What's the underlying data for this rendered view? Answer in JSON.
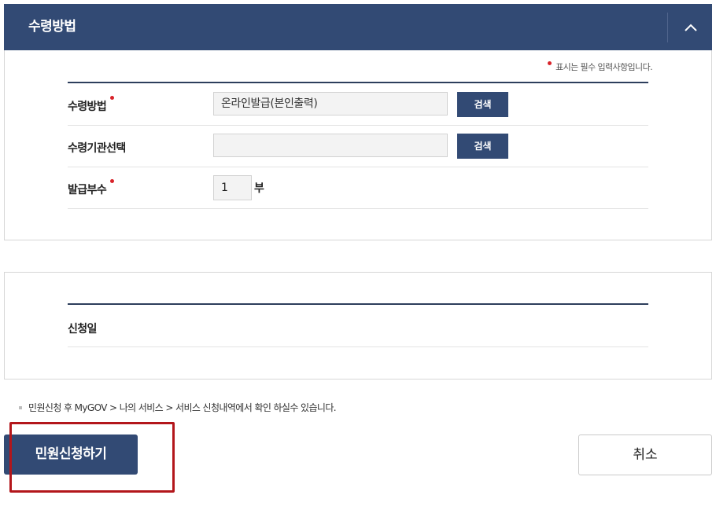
{
  "receipt_section": {
    "title": "수령방법",
    "required_note": "표시는 필수 입력사항입니다.",
    "rows": [
      {
        "label": "수령방법",
        "value": "온라인발급(본인출력)",
        "button": "검색",
        "required": true
      },
      {
        "label": "수령기관선택",
        "value": "",
        "button": "검색",
        "required": false
      },
      {
        "label": "발급부수",
        "value": "1",
        "unit": "부",
        "required": true
      }
    ]
  },
  "application_section": {
    "rows": [
      {
        "label": "신청일"
      }
    ]
  },
  "notice": "민원신청 후 MyGOV > 나의 서비스 > 서비스 신청내역에서 확인 하실수 있습니다.",
  "buttons": {
    "submit": "민원신청하기",
    "cancel": "취소"
  },
  "colors": {
    "primary": "#324a74",
    "required_dot": "#d8232a",
    "highlight": "#b3161b"
  }
}
